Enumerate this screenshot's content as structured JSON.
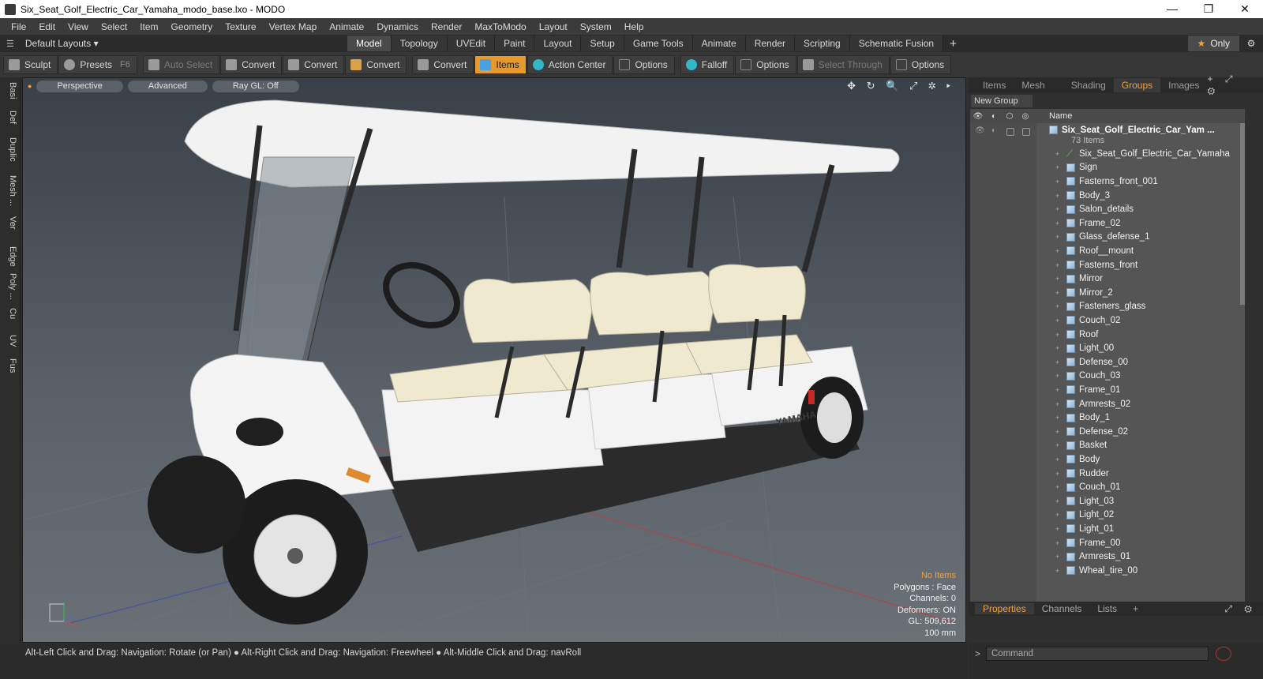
{
  "window": {
    "title": "Six_Seat_Golf_Electric_Car_Yamaha_modo_base.lxo - MODO",
    "controls": [
      "—",
      "❐",
      "✕"
    ]
  },
  "menu": [
    "File",
    "Edit",
    "View",
    "Select",
    "Item",
    "Geometry",
    "Texture",
    "Vertex Map",
    "Animate",
    "Dynamics",
    "Render",
    "MaxToModo",
    "Layout",
    "System",
    "Help"
  ],
  "layout_bar": {
    "layouts_label": "Default Layouts ▾",
    "tabs": [
      "Model",
      "Topology",
      "UVEdit",
      "Paint",
      "Layout",
      "Setup",
      "Game Tools",
      "Animate",
      "Render",
      "Scripting",
      "Schematic Fusion"
    ],
    "active_tab": "Model",
    "plus": "+",
    "only_label": "Only"
  },
  "toolbar": {
    "sculpt": "Sculpt",
    "presets": "Presets",
    "presets_key": "F6",
    "auto_select": "Auto Select",
    "convert": "Convert",
    "items": "Items",
    "action_center": "Action Center",
    "options": "Options",
    "falloff": "Falloff",
    "select_through": "Select Through"
  },
  "left_tabs": [
    "Basi",
    "Def",
    "Duplic",
    "Mesh ...",
    "Ver",
    "Edge",
    "Poly ...",
    "Cu",
    "UV",
    "Fus"
  ],
  "viewport": {
    "perspective": "Perspective",
    "advanced": "Advanced",
    "raygl": "Ray GL: Off",
    "controls": "✥ ↻ 🔍 ⤢ ✲ ▸",
    "info": {
      "selection": "No Items",
      "polygons": "Polygons : Face",
      "channels": "Channels: 0",
      "deformers": "Deformers: ON",
      "gl": "GL: 509,612",
      "scale": "100 mm"
    },
    "brand": "YAMAHA"
  },
  "right_panel": {
    "tabs": [
      "Items",
      "Mesh ...",
      "Shading",
      "Groups",
      "Images"
    ],
    "active_tab": "Groups",
    "new_group": "New Group",
    "name_header": "Name",
    "root": "Six_Seat_Golf_Electric_Car_Yam ...",
    "root_count": "73 Items",
    "items": [
      "Six_Seat_Golf_Electric_Car_Yamaha",
      "Sign",
      "Fasterns_front_001",
      "Body_3",
      "Salon_details",
      "Frame_02",
      "Glass_defense_1",
      "Roof__mount",
      "Fasterns_front",
      "Mirror",
      "Mirror_2",
      "Fasteners_glass",
      "Couch_02",
      "Roof",
      "Light_00",
      "Defense_00",
      "Couch_03",
      "Frame_01",
      "Armrests_02",
      "Body_1",
      "Defense_02",
      "Basket",
      "Body",
      "Rudder",
      "Couch_01",
      "Light_03",
      "Light_02",
      "Light_01",
      "Frame_00",
      "Armrests_01",
      "Wheal_tire_00"
    ],
    "bottom_tabs": [
      "Properties",
      "Channels",
      "Lists"
    ],
    "active_bottom_tab": "Properties"
  },
  "status": {
    "hint": "Alt-Left Click and Drag: Navigation: Rotate (or Pan) ● Alt-Right Click and Drag: Navigation: Freewheel ● Alt-Middle Click and Drag: navRoll",
    "command_placeholder": "Command"
  },
  "colors": {
    "accent": "#f2a23a",
    "active_tool": "#e69a2e"
  }
}
